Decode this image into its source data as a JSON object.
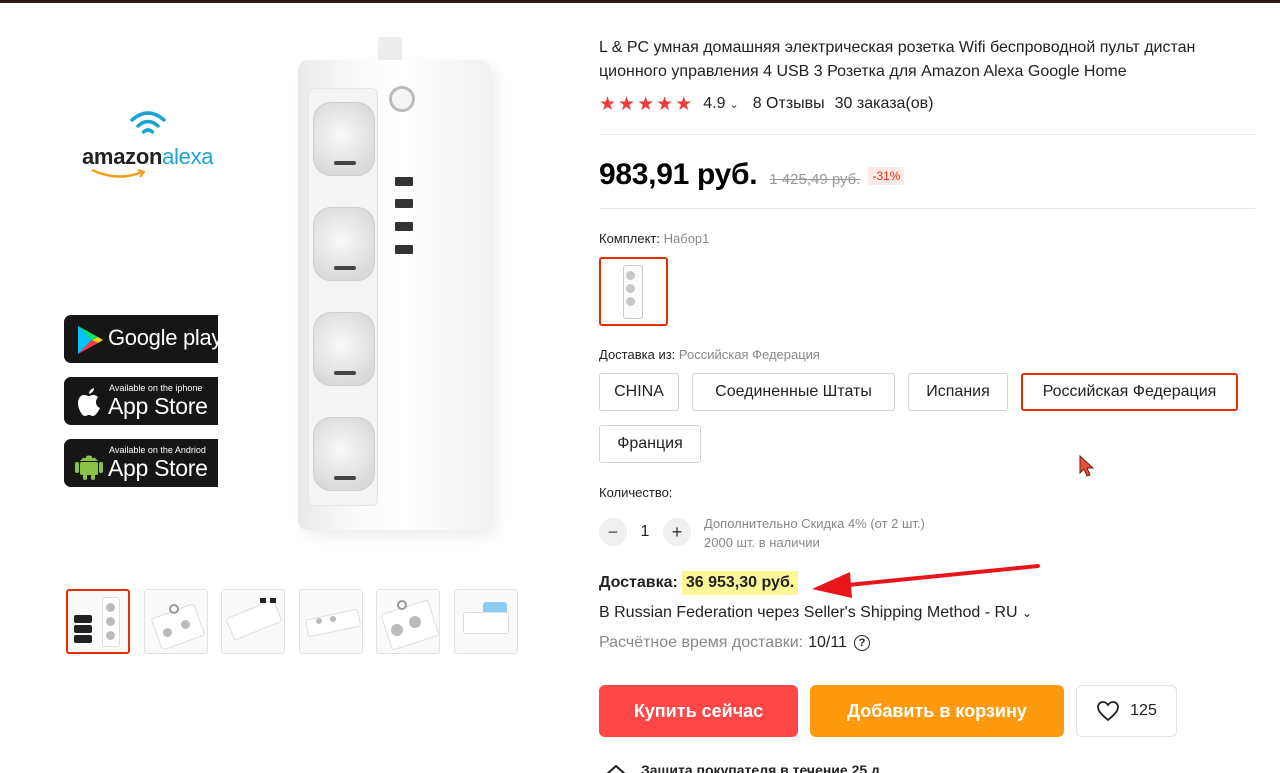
{
  "product": {
    "title": "L & PC умная домашняя электрическая розетка Wifi беспроводной пульт дистан ционного управления 4 USB 3 Розетка для Amazon Alexa Google Home",
    "rating": {
      "stars": 5,
      "value": "4.9",
      "reviews": "8 Отзывы",
      "orders": "30 заказа(ов)"
    },
    "price": "983,91 руб.",
    "old_price": "1 425,49 руб.",
    "discount": "-31%"
  },
  "gallery": {
    "brand_left": "amazon",
    "brand_right": "alexa",
    "badges": [
      {
        "small": "",
        "big": "Google play",
        "icon": "google-play-icon"
      },
      {
        "small": "Available on the iphone",
        "big": "App Store",
        "icon": "apple-icon"
      },
      {
        "small": "Available on the Andriod",
        "big": "App Store",
        "icon": "android-icon"
      }
    ],
    "thumbnail_count": 6
  },
  "sku": {
    "bundle_label": "Комплект:",
    "bundle_value": "Набор1",
    "ship_from_label": "Доставка из:",
    "ship_from_value": "Российская Федерация",
    "options": [
      "CHINA",
      "Соединенные Штаты",
      "Испания",
      "Российская Федерация",
      "Франция"
    ],
    "selected_option": "Российская Федерация"
  },
  "quantity": {
    "label": "Количество:",
    "minus": "−",
    "value": "1",
    "plus": "+",
    "note_discount": "Дополнительно Скидка 4% (от 2 шт.)",
    "note_stock": "2000 шт. в наличии"
  },
  "shipping": {
    "label": "Доставка:",
    "cost": "36 953,30 руб.",
    "method": "В Russian Federation через Seller's Shipping Method - RU",
    "estimate_label": "Расчётное время доставки:",
    "estimate_value": "10/11",
    "help_glyph": "?"
  },
  "actions": {
    "buy_now": "Купить сейчас",
    "add_to_cart": "Добавить в корзину",
    "wishlist_count": "125"
  },
  "protection": {
    "text": "Защита покупателя в течение 25 д"
  },
  "colors": {
    "accent": "#e62e04",
    "buy": "#ff4747",
    "cart": "#ff9a0f",
    "highlight": "#fef79a",
    "star": "#f03a3a"
  }
}
